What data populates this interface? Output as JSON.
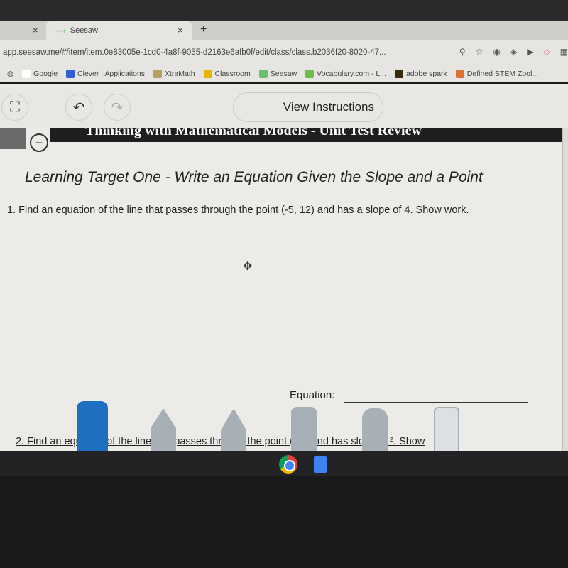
{
  "browser": {
    "tabs": [
      {
        "label": "Seesaw",
        "active": true
      }
    ],
    "new_tab": "+",
    "close": "×",
    "url": "app.seesaw.me/#/item/item.0e83005e-1cd0-4a8f-9055-d2163e6afb0f/edit/class/class.b2036f20-8020-47...",
    "bookmarks": [
      {
        "label": "Google",
        "color": "#4285f4"
      },
      {
        "label": "Clever | Applications",
        "color": "#2f5fd0"
      },
      {
        "label": "XtraMath",
        "color": "#b8a060"
      },
      {
        "label": "Classroom",
        "color": "#e8b400"
      },
      {
        "label": "Seesaw",
        "color": "#6dbf6d"
      },
      {
        "label": "Vocabulary.com - L...",
        "color": "#6cc04a"
      },
      {
        "label": "adobe spark",
        "color": "#3a2a10"
      },
      {
        "label": "Defined STEM Zool...",
        "color": "#e07030"
      }
    ]
  },
  "toolbar": {
    "view_instructions": "View Instructions",
    "undo_icon": "↶",
    "redo_icon": "↷"
  },
  "document": {
    "banner_title": "Thinking with Mathematical Models - Unit Test Review",
    "learning_target": "Learning Target One - Write an Equation Given the Slope and a Point",
    "question1": "1. Find an equation of the line that passes through the point (-5, 12) and has a slope of 4.  Show work.",
    "equation_label": "Equation:",
    "question2": "2. Find an equation of the line that passes through the point (-1 ) and has slope of ². Show"
  },
  "colors": {
    "hand_tool": "#1e6fc0",
    "pen_tools": "#a7b0b7"
  }
}
